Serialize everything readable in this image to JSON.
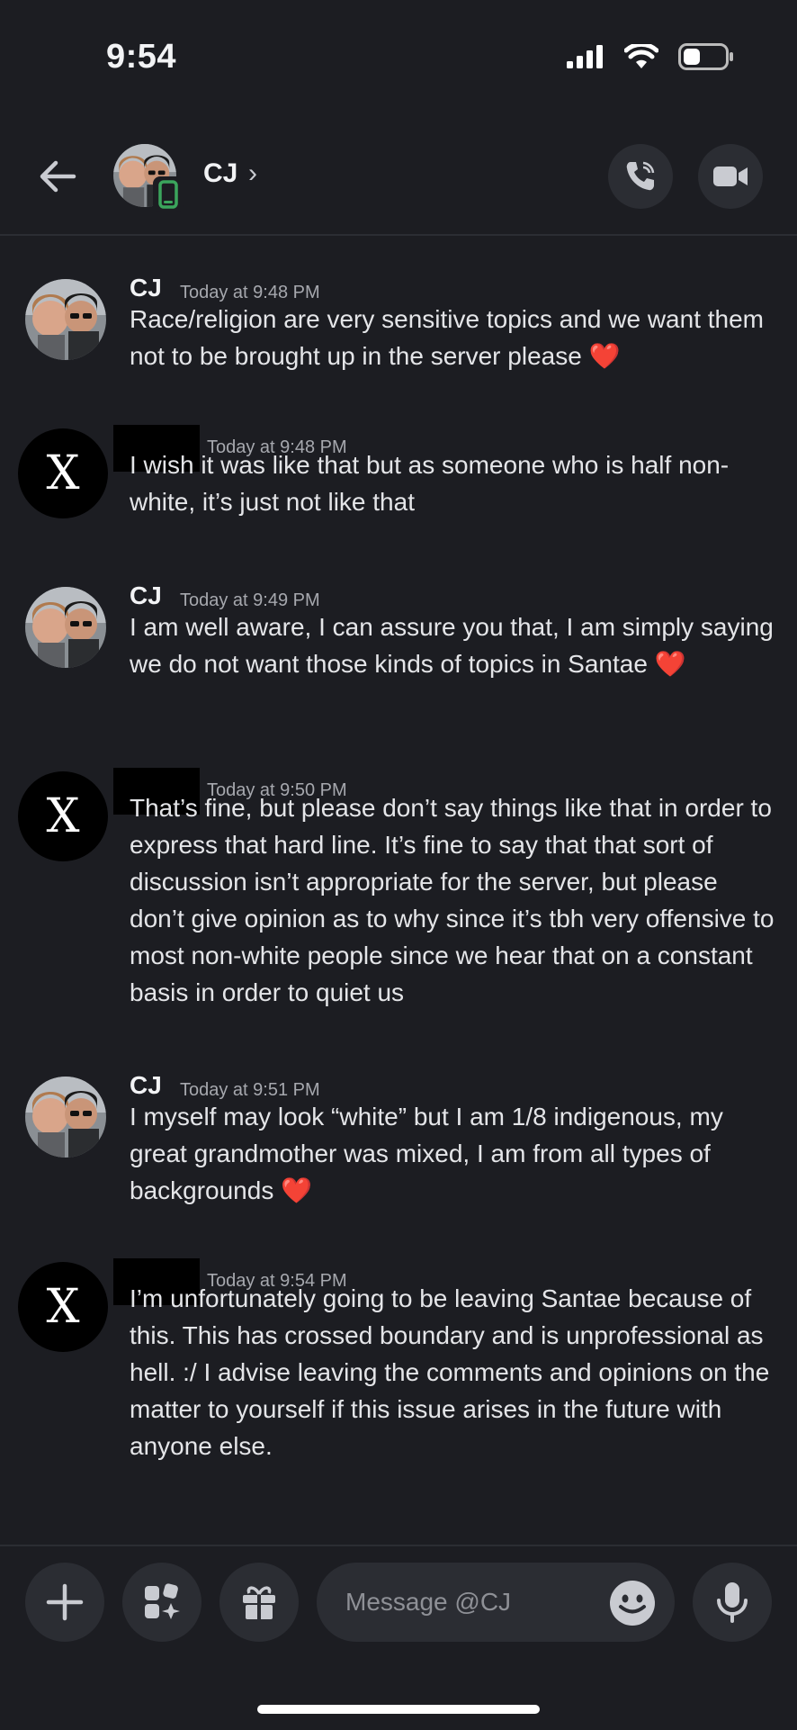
{
  "status_bar": {
    "time": "9:54"
  },
  "header": {
    "title": "CJ",
    "chevron": "›"
  },
  "messages": [
    {
      "author": "CJ",
      "timestamp": "Today at 9:48 PM",
      "text": "Race/religion are very sensitive topics and we want them not to be brought up in the server please",
      "has_heart": true
    },
    {
      "author": "",
      "timestamp": "Today at 9:48 PM",
      "text": "I wish it was like that but as someone who is half non-white, it’s just not like that",
      "has_heart": false
    },
    {
      "author": "CJ",
      "timestamp": "Today at 9:49 PM",
      "text": "I am well aware, I can assure you that, I am simply saying we do not want those kinds of topics in Santae",
      "has_heart": true
    },
    {
      "author": "",
      "timestamp": "Today at 9:50 PM",
      "text": "That’s fine, but please don’t say things like that in order to express that hard line. It’s fine to say that that sort of discussion isn’t appropriate for the server, but please don’t give opinion as to why since it’s tbh very offensive to most non-white people since we hear that on a constant basis in order to quiet us",
      "has_heart": false
    },
    {
      "author": "CJ",
      "timestamp": "Today at 9:51 PM",
      "text": "I myself may look “white” but I am 1/8 indigenous, my great grandmother was mixed, I am from all types of backgrounds",
      "has_heart": true
    },
    {
      "author": "",
      "timestamp": "Today at 9:54 PM",
      "text": "I’m unfortunately going to be leaving Santae because of this. This has crossed boundary and is unprofessional as hell. :/ I advise leaving the comments and opinions on the matter to yourself if this issue arises in the future with anyone else.",
      "has_heart": false
    }
  ],
  "avatar_letter": "X",
  "heart_emoji": "❤️",
  "composer": {
    "placeholder": "Message @CJ"
  },
  "colors": {
    "background": "#1c1d22",
    "surface": "#2b2d33",
    "heart": "#e8213a"
  },
  "icons": [
    "back-arrow-icon",
    "phone-icon",
    "voice-call-icon",
    "video-camera-icon",
    "plus-icon",
    "apps-icon",
    "gift-icon",
    "emoji-icon",
    "microphone-icon"
  ]
}
